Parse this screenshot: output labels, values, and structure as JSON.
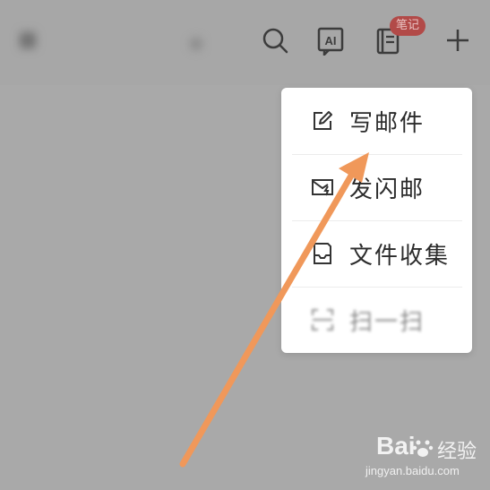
{
  "header": {
    "badge": "笔记"
  },
  "menu": {
    "items": [
      {
        "label": "写邮件",
        "icon": "edit-icon"
      },
      {
        "label": "发闪邮",
        "icon": "flash-mail-icon"
      },
      {
        "label": "文件收集",
        "icon": "file-collect-icon"
      },
      {
        "label": "扫一扫",
        "icon": "scan-icon"
      }
    ]
  },
  "watermark": {
    "logo_text": "Bai",
    "brand": "经验",
    "url": "jingyan.baidu.com"
  },
  "colors": {
    "overlay": "#a9a9a9",
    "menu_bg": "#ffffff",
    "arrow": "#f0985a",
    "badge": "#b24a48"
  }
}
